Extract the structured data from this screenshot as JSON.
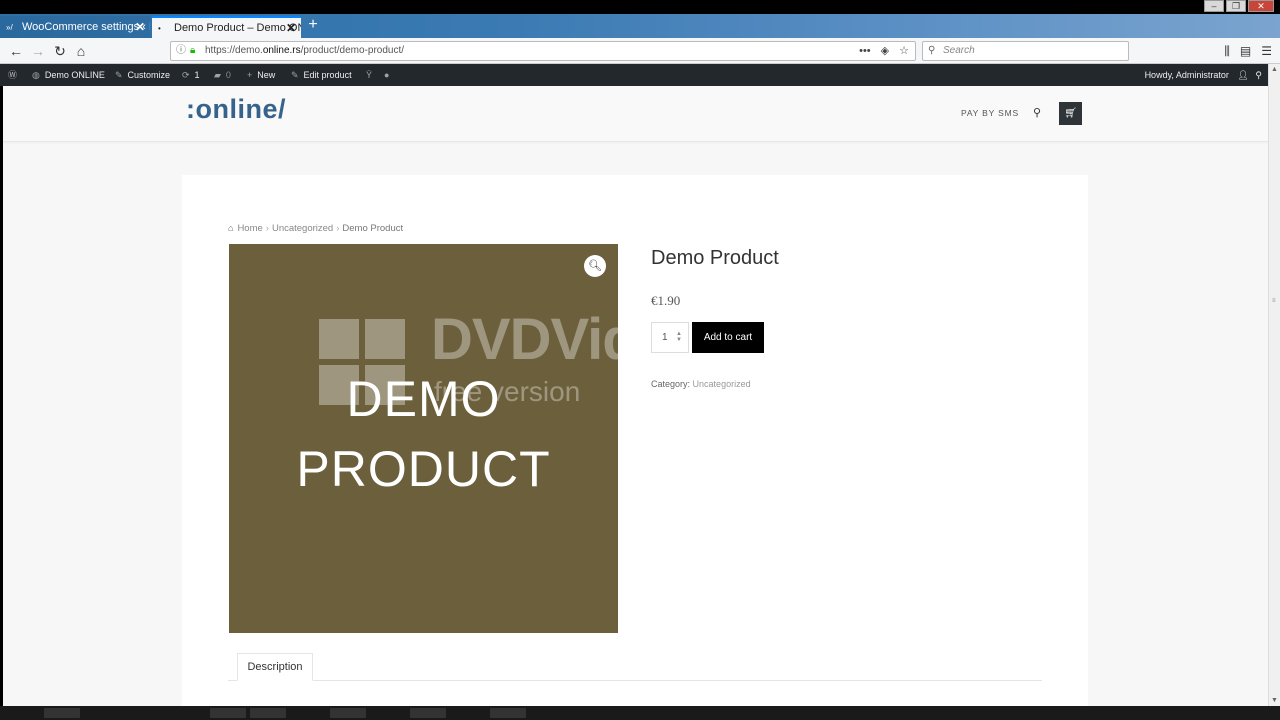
{
  "browser": {
    "tabs": [
      {
        "title": "WooCommerce settings ‹ Demo",
        "icon": "woo-icon",
        "active": false
      },
      {
        "title": "Demo Product – Demo ONLINE",
        "icon": "site-dot-icon",
        "active": true
      }
    ],
    "new_tab": "+",
    "url": {
      "prefix": "https://demo.",
      "domain": "online.rs",
      "path": "/product/demo-product/"
    },
    "search_placeholder": "Search"
  },
  "adminbar": {
    "site_name": "Demo ONLINE",
    "customize": "Customize",
    "updates_count": "1",
    "comments_count": "0",
    "new": "New",
    "edit_product": "Edit product",
    "howdy": "Howdy, Administrator"
  },
  "site": {
    "logo": ":online/",
    "menu_sms": "PAY BY SMS"
  },
  "breadcrumb": {
    "home": "Home",
    "category": "Uncategorized",
    "current": "Demo Product",
    "separator": "›"
  },
  "product": {
    "title": "Demo Product",
    "price": "€1.90",
    "quantity": "1",
    "add_to_cart": "Add to cart",
    "category_label": "Category:",
    "category_value": "Uncategorized",
    "image_line1": "DEMO",
    "image_line2": "PRODUCT",
    "image_bg_color": "#6c5f3c",
    "watermark_text": "DVDVid",
    "watermark_sub": "free version"
  },
  "tabs": {
    "description": "Description"
  },
  "colors": {
    "logo": "#35638c",
    "adminbar": "#23282d",
    "tab_accent": "#0a84ff",
    "add_to_cart_bg": "#000000"
  }
}
